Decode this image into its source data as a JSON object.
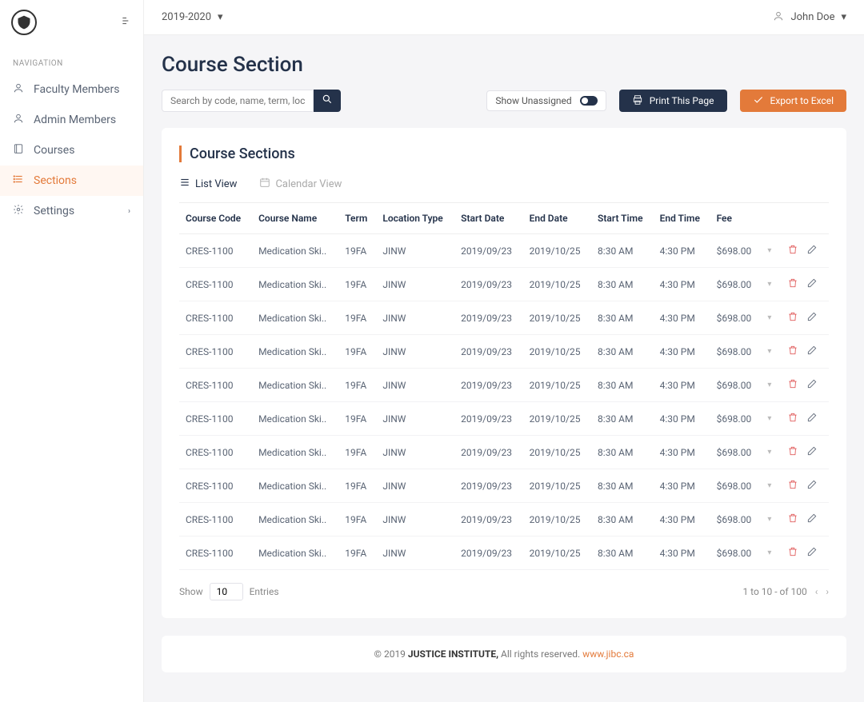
{
  "header": {
    "year": "2019-2020",
    "user": "John Doe"
  },
  "nav": {
    "label": "NAVIGATION",
    "items": [
      {
        "icon": "user",
        "label": "Faculty Members"
      },
      {
        "icon": "user",
        "label": "Admin Members"
      },
      {
        "icon": "book",
        "label": "Courses"
      },
      {
        "icon": "list",
        "label": "Sections",
        "active": true
      },
      {
        "icon": "gear",
        "label": "Settings",
        "chevron": true
      }
    ]
  },
  "page": {
    "title": "Course Section",
    "section_title": "Course Sections",
    "search_placeholder": "Search by code, name, term, location",
    "unassigned_label": "Show Unassigned",
    "print_label": "Print This Page",
    "export_label": "Export to Excel",
    "list_view_label": "List View",
    "calendar_view_label": "Calendar View"
  },
  "table": {
    "headers": [
      "Course Code",
      "Course Name",
      "Term",
      "Location Type",
      "Start Date",
      "End Date",
      "Start Time",
      "End Time",
      "Fee"
    ],
    "rows": [
      {
        "code": "CRES-1100",
        "name": "Medication Ski..",
        "term": "19FA",
        "loc": "JINW",
        "sdate": "2019/09/23",
        "edate": "2019/10/25",
        "stime": "8:30 AM",
        "etime": "4:30 PM",
        "fee": "$698.00"
      },
      {
        "code": "CRES-1100",
        "name": "Medication Ski..",
        "term": "19FA",
        "loc": "JINW",
        "sdate": "2019/09/23",
        "edate": "2019/10/25",
        "stime": "8:30 AM",
        "etime": "4:30 PM",
        "fee": "$698.00"
      },
      {
        "code": "CRES-1100",
        "name": "Medication Ski..",
        "term": "19FA",
        "loc": "JINW",
        "sdate": "2019/09/23",
        "edate": "2019/10/25",
        "stime": "8:30 AM",
        "etime": "4:30 PM",
        "fee": "$698.00"
      },
      {
        "code": "CRES-1100",
        "name": "Medication Ski..",
        "term": "19FA",
        "loc": "JINW",
        "sdate": "2019/09/23",
        "edate": "2019/10/25",
        "stime": "8:30 AM",
        "etime": "4:30 PM",
        "fee": "$698.00"
      },
      {
        "code": "CRES-1100",
        "name": "Medication Ski..",
        "term": "19FA",
        "loc": "JINW",
        "sdate": "2019/09/23",
        "edate": "2019/10/25",
        "stime": "8:30 AM",
        "etime": "4:30 PM",
        "fee": "$698.00"
      },
      {
        "code": "CRES-1100",
        "name": "Medication Ski..",
        "term": "19FA",
        "loc": "JINW",
        "sdate": "2019/09/23",
        "edate": "2019/10/25",
        "stime": "8:30 AM",
        "etime": "4:30 PM",
        "fee": "$698.00"
      },
      {
        "code": "CRES-1100",
        "name": "Medication Ski..",
        "term": "19FA",
        "loc": "JINW",
        "sdate": "2019/09/23",
        "edate": "2019/10/25",
        "stime": "8:30 AM",
        "etime": "4:30 PM",
        "fee": "$698.00"
      },
      {
        "code": "CRES-1100",
        "name": "Medication Ski..",
        "term": "19FA",
        "loc": "JINW",
        "sdate": "2019/09/23",
        "edate": "2019/10/25",
        "stime": "8:30 AM",
        "etime": "4:30 PM",
        "fee": "$698.00"
      },
      {
        "code": "CRES-1100",
        "name": "Medication Ski..",
        "term": "19FA",
        "loc": "JINW",
        "sdate": "2019/09/23",
        "edate": "2019/10/25",
        "stime": "8:30 AM",
        "etime": "4:30 PM",
        "fee": "$698.00"
      },
      {
        "code": "CRES-1100",
        "name": "Medication Ski..",
        "term": "19FA",
        "loc": "JINW",
        "sdate": "2019/09/23",
        "edate": "2019/10/25",
        "stime": "8:30 AM",
        "etime": "4:30 PM",
        "fee": "$698.00"
      }
    ]
  },
  "pagination": {
    "show_label": "Show",
    "page_size": "10",
    "entries_label": "Entries",
    "range_text": "1 to 10 - of  100"
  },
  "footer": {
    "copyright_prefix": "© 2019 ",
    "institute": "JUSTICE INSTITUTE,",
    "rights": "  All rights reserved. ",
    "url": "www.jibc.ca"
  }
}
